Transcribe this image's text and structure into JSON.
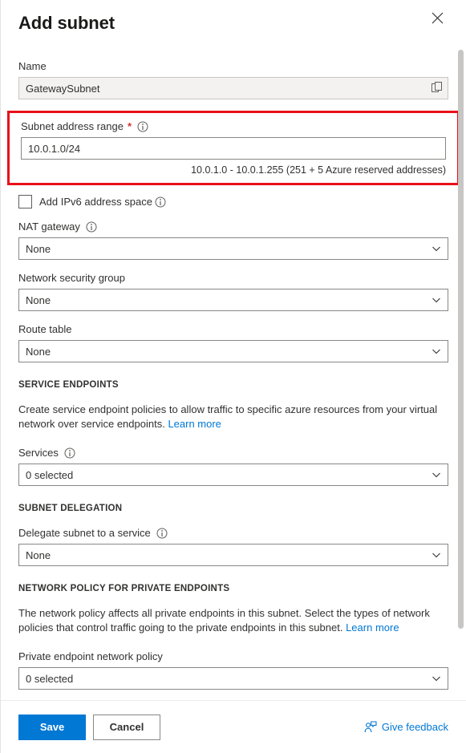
{
  "blade": {
    "title": "Add subnet",
    "close_label": "Close",
    "close_icon": "close-icon"
  },
  "form": {
    "name": {
      "label": "Name",
      "value": "GatewaySubnet",
      "placeholder": "",
      "copy_icon": "copy-icon",
      "disabled": true
    },
    "subnet_address_range": {
      "label": "Subnet address range",
      "required_marker": "*",
      "info_icon": "info-icon",
      "value": "10.0.1.0/24",
      "placeholder": "",
      "help_text": "10.0.1.0 - 10.0.1.255 (251 + 5 Azure reserved addresses)",
      "highlight_color": "#e8101a"
    },
    "add_ipv6": {
      "label": "Add IPv6 address space",
      "checked": false,
      "info_icon": "info-icon"
    },
    "nat_gateway": {
      "label": "NAT gateway",
      "info_icon": "info-icon",
      "value": "None",
      "chevron_icon": "chevron-down-icon"
    },
    "network_security_group": {
      "label": "Network security group",
      "value": "None",
      "chevron_icon": "chevron-down-icon"
    },
    "route_table": {
      "label": "Route table",
      "value": "None",
      "chevron_icon": "chevron-down-icon"
    }
  },
  "service_endpoints": {
    "heading": "SERVICE ENDPOINTS",
    "description_part1": "Create service endpoint policies to allow traffic to specific azure resources from your virtual network over service endpoints.",
    "learn_more": "Learn more",
    "services": {
      "label": "Services",
      "info_icon": "info-icon",
      "value": "0 selected",
      "chevron_icon": "chevron-down-icon"
    }
  },
  "subnet_delegation": {
    "heading": "SUBNET DELEGATION",
    "delegate": {
      "label": "Delegate subnet to a service",
      "info_icon": "info-icon",
      "value": "None",
      "chevron_icon": "chevron-down-icon"
    }
  },
  "network_policy": {
    "heading": "NETWORK POLICY FOR PRIVATE ENDPOINTS",
    "description_part1": "The network policy affects all private endpoints in this subnet. Select the types of network policies that control traffic going to the private endpoints in this subnet.",
    "learn_more": "Learn more",
    "private_endpoint_network_policy": {
      "label": "Private endpoint network policy",
      "value": "0 selected",
      "chevron_icon": "chevron-down-icon"
    }
  },
  "footer": {
    "save_label": "Save",
    "cancel_label": "Cancel",
    "feedback_label": "Give feedback",
    "feedback_icon": "person-feedback-icon",
    "accent_color": "#0078d4"
  }
}
